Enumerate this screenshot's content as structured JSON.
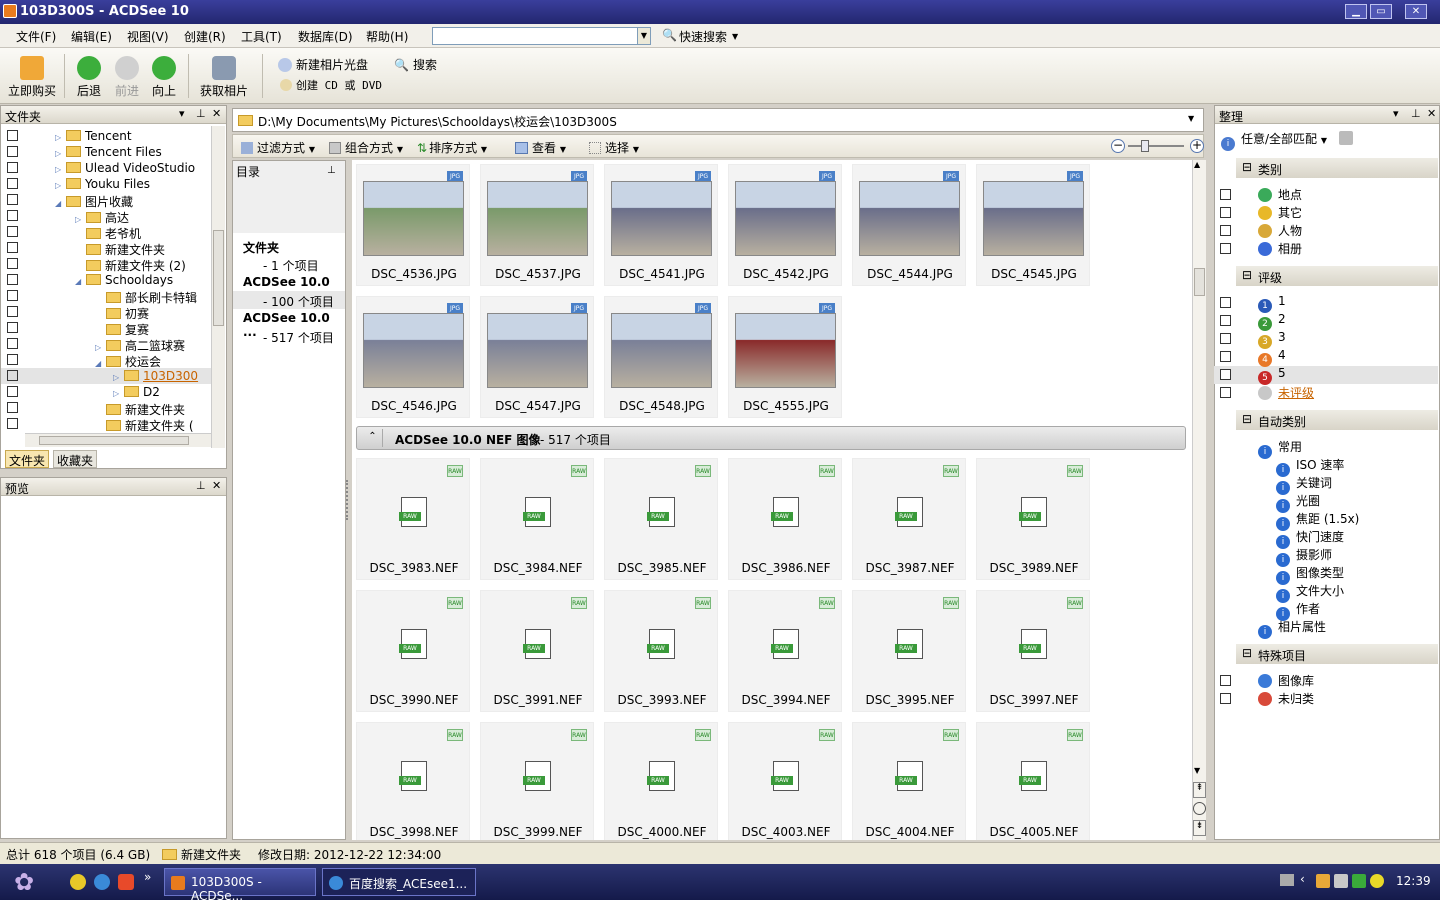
{
  "window": {
    "title": "103D300S - ACDSee 10"
  },
  "menu": [
    "文件(F)",
    "编辑(E)",
    "视图(V)",
    "创建(R)",
    "工具(T)",
    "数据库(D)",
    "帮助(H)"
  ],
  "quick_search": {
    "label": "快速搜索",
    "value": ""
  },
  "toolbar": {
    "buy": "立即购买",
    "back": "后退",
    "forward": "前进",
    "up": "向上",
    "acquire": "获取相片",
    "new_disc": "新建相片光盘",
    "create_cd": "创建 CD 或 DVD",
    "search": "搜索"
  },
  "folders": {
    "title": "文件夹",
    "tab_folders": "文件夹",
    "tab_favorites": "收藏夹",
    "items": [
      {
        "label": "Tencent"
      },
      {
        "label": "Tencent Files"
      },
      {
        "label": "Ulead VideoStudio"
      },
      {
        "label": "Youku Files"
      },
      {
        "label": "图片收藏"
      },
      {
        "label": "高达"
      },
      {
        "label": "老爷机"
      },
      {
        "label": "新建文件夹"
      },
      {
        "label": "新建文件夹 (2)"
      },
      {
        "label": "Schooldays"
      },
      {
        "label": "部长刷卡特辑"
      },
      {
        "label": "初赛"
      },
      {
        "label": "复赛"
      },
      {
        "label": "高二篮球赛"
      },
      {
        "label": "校运会"
      },
      {
        "label": "103D300"
      },
      {
        "label": "D2"
      },
      {
        "label": "新建文件夹"
      },
      {
        "label": "新建文件夹 ("
      }
    ]
  },
  "preview": {
    "title": "预览"
  },
  "path": "D:\\My Documents\\My Pictures\\Schooldays\\校运会\\103D300S",
  "browse_toolbar": {
    "filter": "过滤方式",
    "group": "组合方式",
    "sort": "排序方式",
    "view": "查看",
    "select": "选择"
  },
  "directory": {
    "title": "目录",
    "folder_label": "文件夹",
    "folder_count": "- 1 个项目",
    "group1": "ACDSee 10.0 ...",
    "group1_count": "- 100 个项目",
    "group2": "ACDSee 10.0 ...",
    "group2_count": "- 517 个项目"
  },
  "jpg_files": [
    "DSC_4536.JPG",
    "DSC_4537.JPG",
    "DSC_4541.JPG",
    "DSC_4542.JPG",
    "DSC_4544.JPG",
    "DSC_4545.JPG",
    "DSC_4546.JPG",
    "DSC_4547.JPG",
    "DSC_4548.JPG",
    "DSC_4555.JPG"
  ],
  "nef_group": {
    "title": "ACDSee 10.0 NEF 图像",
    "count": "- 517 个项目"
  },
  "nef_files": [
    "DSC_3983.NEF",
    "DSC_3984.NEF",
    "DSC_3985.NEF",
    "DSC_3986.NEF",
    "DSC_3987.NEF",
    "DSC_3989.NEF",
    "DSC_3990.NEF",
    "DSC_3991.NEF",
    "DSC_3993.NEF",
    "DSC_3994.NEF",
    "DSC_3995.NEF",
    "DSC_3997.NEF",
    "DSC_3998.NEF",
    "DSC_3999.NEF",
    "DSC_4000.NEF",
    "DSC_4003.NEF",
    "DSC_4004.NEF",
    "DSC_4005.NEF"
  ],
  "organize": {
    "title": "整理",
    "match": "任意/全部匹配",
    "cat_title": "类别",
    "categories": [
      "地点",
      "其它",
      "人物",
      "相册"
    ],
    "rating_title": "评级",
    "ratings": [
      "1",
      "2",
      "3",
      "4",
      "5"
    ],
    "unrated": "未评级",
    "auto_title": "自动类别",
    "auto_root": "常用",
    "auto_items": [
      "ISO 速率",
      "关键词",
      "光圈",
      "焦距 (1.5x)",
      "快门速度",
      "摄影师",
      "图像类型",
      "文件大小",
      "作者"
    ],
    "photo_attr": "相片属性",
    "special_title": "特殊项目",
    "special": [
      "图像库",
      "未归类"
    ]
  },
  "status": {
    "total": "总计 618 个项目 (6.4 GB)",
    "folder": "新建文件夹",
    "modified": "修改日期: 2012-12-22 12:34:00"
  },
  "taskbar": {
    "task1": "103D300S - ACDSe...",
    "task2": "百度搜索_ACEsee1...",
    "time": "12:39"
  }
}
